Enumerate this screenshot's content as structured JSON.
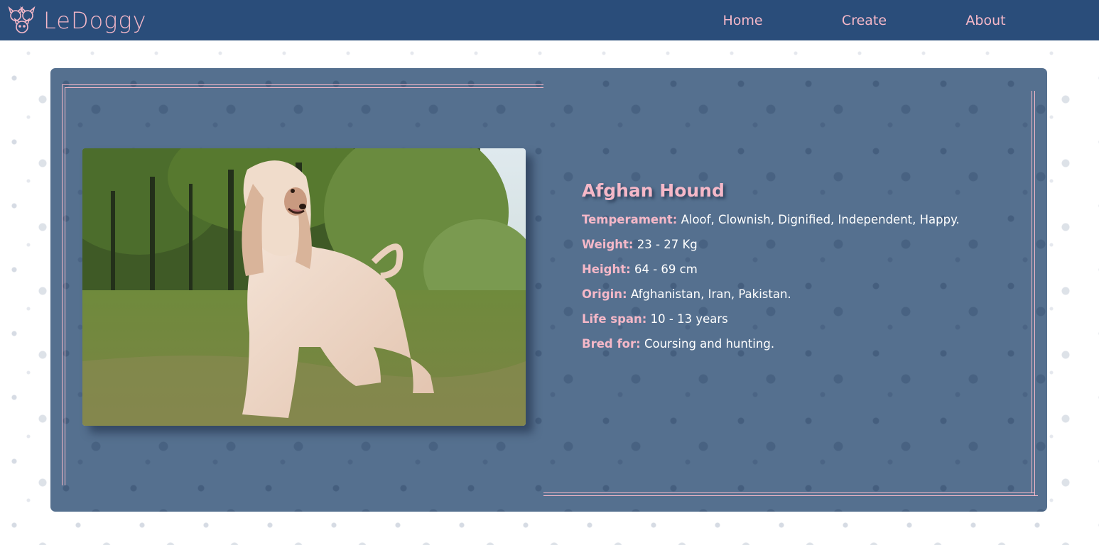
{
  "brand": {
    "name": "LeDoggy",
    "icon": "dog-faces-logo-icon"
  },
  "nav": {
    "items": [
      {
        "label": "Home"
      },
      {
        "label": "Create"
      },
      {
        "label": "About"
      }
    ]
  },
  "dog": {
    "name": "Afghan Hound",
    "image": {
      "subject": "dog-photo"
    },
    "fields": [
      {
        "label": "Temperament:",
        "value": "Aloof, Clownish, Dignified, Independent, Happy."
      },
      {
        "label": "Weight:",
        "value": "23 - 27 Kg"
      },
      {
        "label": "Height:",
        "value": "64 - 69 cm"
      },
      {
        "label": "Origin:",
        "value": "Afghanistan, Iran, Pakistan."
      },
      {
        "label": "Life span:",
        "value": "10 - 13 years"
      },
      {
        "label": "Bred for:",
        "value": "Coursing and hunting."
      }
    ]
  },
  "colors": {
    "navbar": "#2a4d7a",
    "accent": "#f5b8c8",
    "card": "#55708f",
    "text": "#ffffff"
  }
}
